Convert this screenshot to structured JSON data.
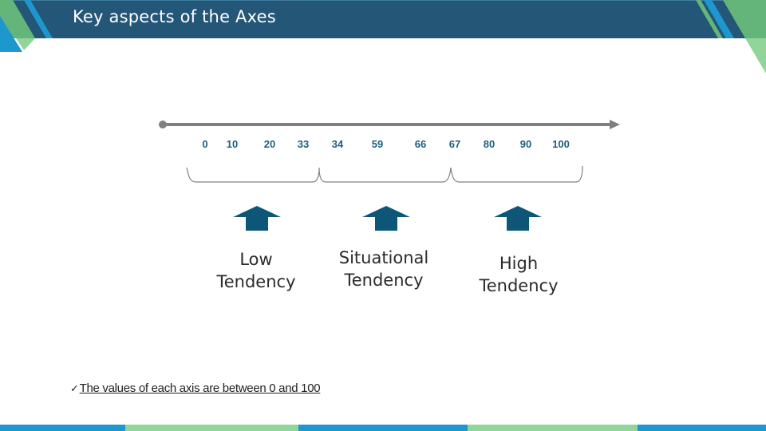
{
  "header": {
    "title": "Key aspects of the Axes"
  },
  "colors": {
    "header_navy": "#245677",
    "accent_blue": "#1e97cf",
    "accent_green": "#63b57a",
    "light_green": "#91d59a",
    "axis_gray": "#808080",
    "tick_text": "#1f5f7c",
    "arrow_fill": "#0e5677"
  },
  "chart_data": {
    "type": "number-line",
    "range": [
      0,
      100
    ],
    "ticks": [
      "0",
      "10",
      "20",
      "33",
      "34",
      "59",
      "66",
      "67",
      "80",
      "90",
      "100"
    ],
    "groups": [
      {
        "label_line1": "Low",
        "label_line2": "Tendency",
        "from": 0,
        "to": 33
      },
      {
        "label_line1": "Situational",
        "label_line2": "Tendency",
        "from": 34,
        "to": 66
      },
      {
        "label_line1": "High",
        "label_line2": "Tendency",
        "from": 67,
        "to": 100
      }
    ]
  },
  "note": {
    "check_icon": "✓",
    "text": "The values of each axis are between 0 and 100"
  },
  "footer": {
    "segments": [
      "blue",
      "green",
      "blue",
      "green",
      "blue"
    ]
  }
}
